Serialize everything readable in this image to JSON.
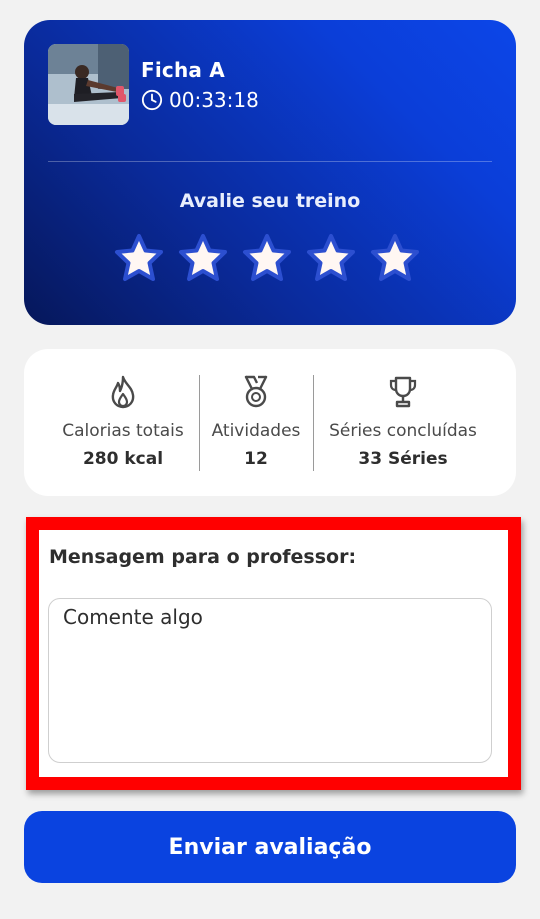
{
  "workout": {
    "title": "Ficha A",
    "duration": "00:33:18",
    "thumbnail_icon": "athlete-stretching-photo"
  },
  "rating": {
    "label": "Avalie seu treino",
    "max_stars": 5,
    "selected": 0
  },
  "stats": [
    {
      "icon": "flame-icon",
      "label": "Calorias totais",
      "value": "280 kcal"
    },
    {
      "icon": "medal-icon",
      "label": "Atividades",
      "value": "12"
    },
    {
      "icon": "trophy-icon",
      "label": "Séries concluídas",
      "value": "33 Séries"
    }
  ],
  "message": {
    "label": "Mensagem para o professor:",
    "placeholder": "Comente algo",
    "value": ""
  },
  "submit": {
    "label": "Enviar avaliação"
  },
  "colors": {
    "primary": "#0a43e0",
    "card_gradient_dark": "#06175a",
    "highlight_border": "#ff0000",
    "star_fill": "#fff7f3",
    "star_stroke": "#2c4fd0"
  }
}
